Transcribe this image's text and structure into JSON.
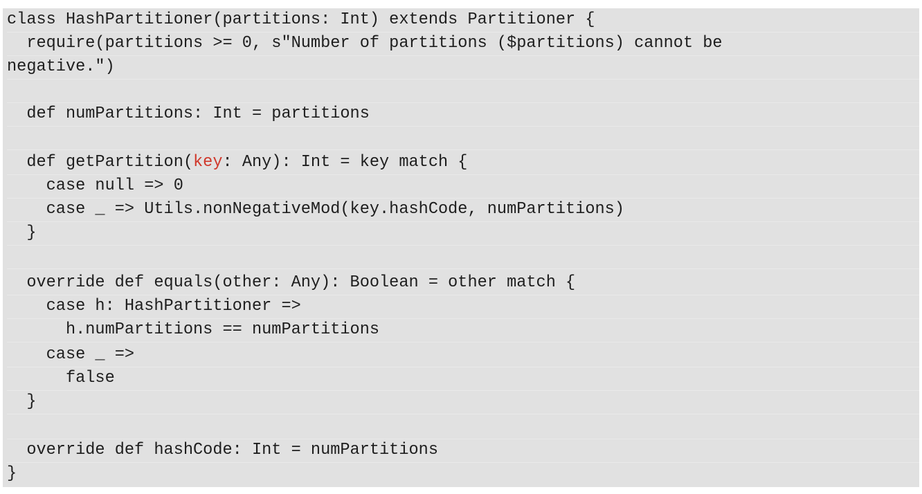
{
  "code": {
    "lines": [
      "class HashPartitioner(partitions: Int) extends Partitioner {",
      "  require(partitions >= 0, s\"Number of partitions ($partitions) cannot be",
      "negative.\")",
      "",
      "  def numPartitions: Int = partitions",
      "",
      "  def getPartition(key: Any): Int = key match {",
      "    case null => 0",
      "    case _ => Utils.nonNegativeMod(key.hashCode, numPartitions)",
      "  }",
      "",
      "  override def equals(other: Any): Boolean = other match {",
      "    case h: HashPartitioner =>",
      "      h.numPartitions == numPartitions",
      "    case _ =>",
      "      false",
      "  }",
      "",
      "  override def hashCode: Int = numPartitions",
      "}"
    ],
    "get_partition_line": {
      "prefix": "  def getPartition(",
      "highlight": "key",
      "suffix": ": Any): Int = key match {"
    },
    "highlight_color": "#d0382b",
    "background_color": "#e1e1e1"
  }
}
